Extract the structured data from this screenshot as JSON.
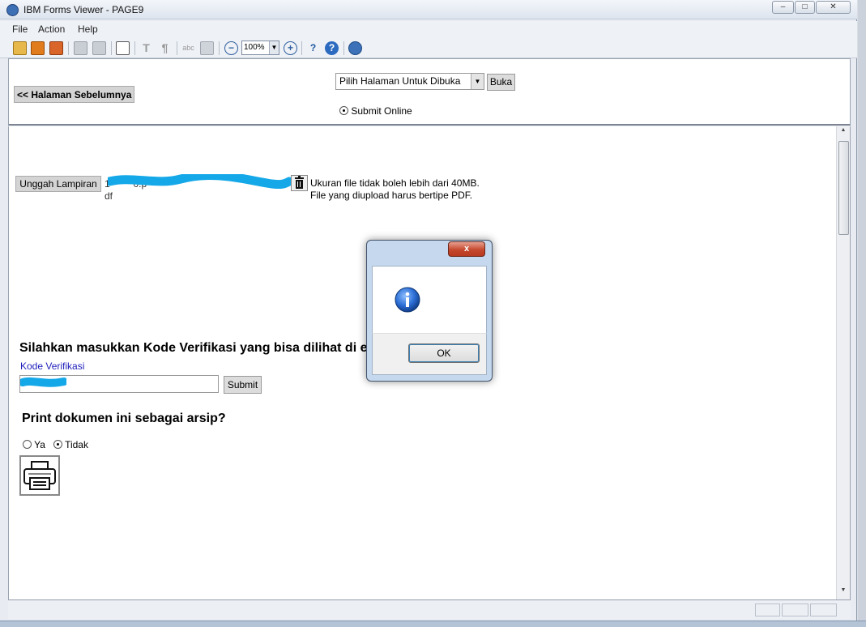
{
  "window": {
    "title": "IBM Forms Viewer - PAGE9"
  },
  "menu": [
    "File",
    "Action",
    "Help"
  ],
  "toolbar": {
    "zoom": "100%"
  },
  "nav": {
    "back_label": "<< Halaman Sebelumnya",
    "page_select_value": "Pilih Halaman Untuk Dibuka",
    "open_label": "Buka",
    "submit_online_label": "Submit Online"
  },
  "upload": {
    "button_label": "Unggah Lampiran",
    "file_name_line1": "1            0.p",
    "file_name_line2": "df",
    "note_line1": "Ukuran file tidak boleh lebih dari 40MB.",
    "note_line2": "File yang diupload harus bertipe PDF."
  },
  "verification": {
    "heading": "Silahkan masukkan Kode Verifikasi yang bisa dilihat di e",
    "label": "Kode Verifikasi",
    "submit_label": "Submit"
  },
  "print": {
    "heading": "Print dokumen ini sebagai arsip?",
    "option_yes": "Ya",
    "option_no": "Tidak",
    "selected": "Tidak"
  },
  "dialog": {
    "close_glyph": "x",
    "ok_label": "OK"
  },
  "colors": {
    "redaction": "#14a8e8",
    "link_label": "#1d1dbb"
  }
}
